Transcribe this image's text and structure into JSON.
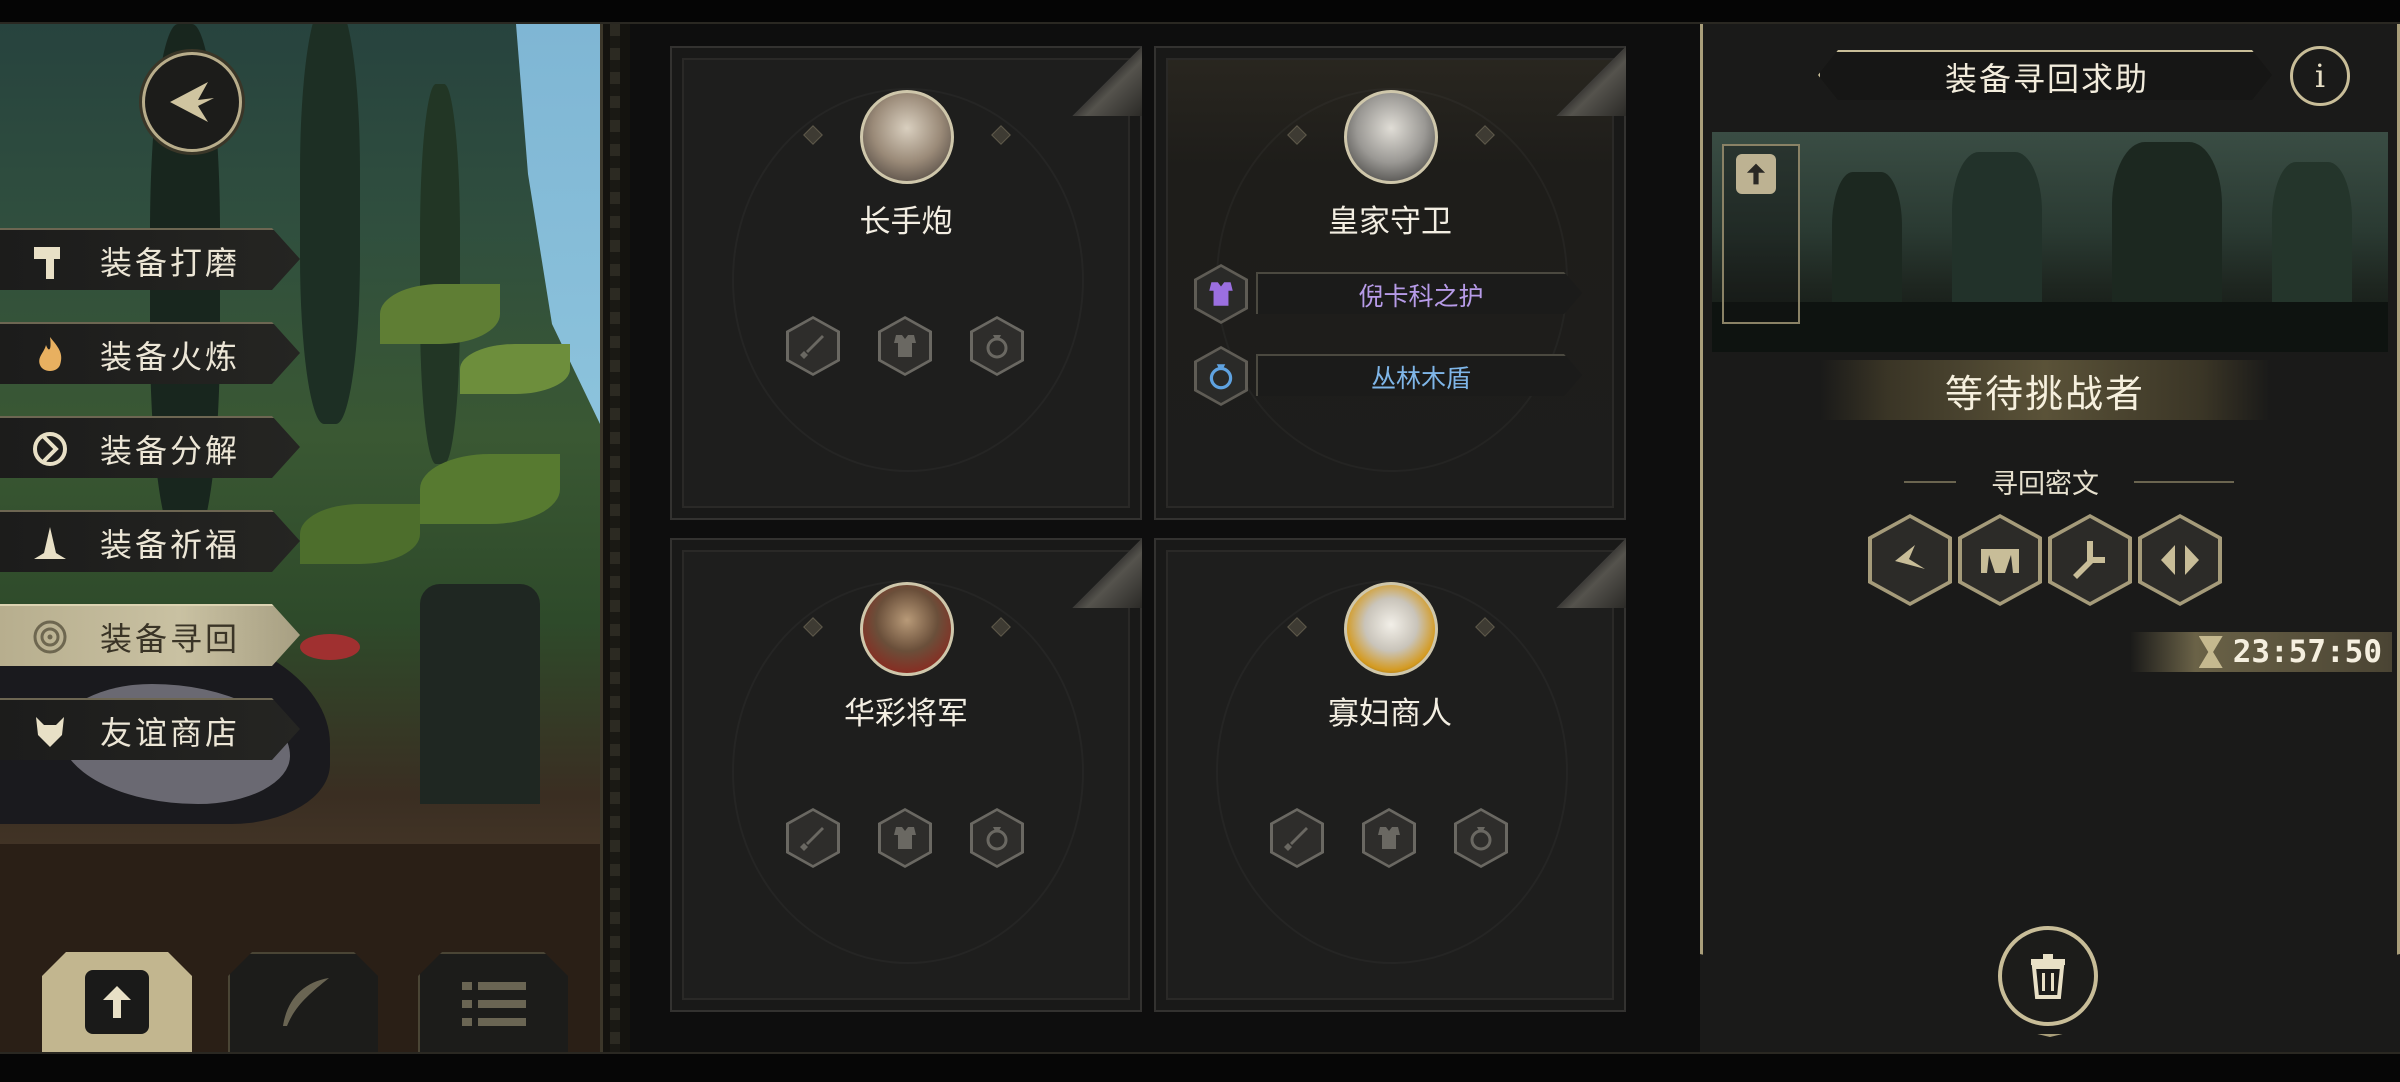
{
  "menu": {
    "items": [
      {
        "label": "装备打磨",
        "icon": "hammer-icon",
        "active": false
      },
      {
        "label": "装备火炼",
        "icon": "flame-icon",
        "active": false
      },
      {
        "label": "装备分解",
        "icon": "decompose-icon",
        "active": false
      },
      {
        "label": "装备祈福",
        "icon": "praying-hands-icon",
        "active": false
      },
      {
        "label": "装备寻回",
        "icon": "target-icon",
        "active": true
      },
      {
        "label": "友谊商店",
        "icon": "wolf-icon",
        "active": false
      }
    ]
  },
  "bottom_tabs": [
    {
      "icon": "upload-icon",
      "active": true
    },
    {
      "icon": "feather-icon",
      "active": false
    },
    {
      "icon": "list-icon",
      "active": false
    }
  ],
  "heroes": [
    {
      "name": "长手炮",
      "slots": [
        "sword-icon",
        "armor-icon",
        "ring-icon"
      ],
      "equipment": []
    },
    {
      "name": "皇家守卫",
      "slots": [],
      "equipment": [
        {
          "name": "倪卡科之护",
          "icon": "armor-icon",
          "color": "#b79be8"
        },
        {
          "name": "丛林木盾",
          "icon": "ring-icon",
          "color": "#7fb6e8"
        }
      ]
    },
    {
      "name": "华彩将军",
      "slots": [
        "sword-icon",
        "armor-icon",
        "ring-icon"
      ],
      "equipment": []
    },
    {
      "name": "寡妇商人",
      "slots": [
        "sword-icon",
        "armor-icon",
        "ring-icon"
      ],
      "equipment": []
    }
  ],
  "panel": {
    "title": "装备寻回求助",
    "status": "等待挑战者",
    "code_title": "寻回密文",
    "runes": [
      "rune-1-icon",
      "rune-2-icon",
      "rune-3-icon",
      "rune-4-icon"
    ],
    "timer": "23:57:50"
  },
  "colors": {
    "gold": "#c8bd98",
    "purple": "#b79be8",
    "blue": "#7fb6e8"
  }
}
